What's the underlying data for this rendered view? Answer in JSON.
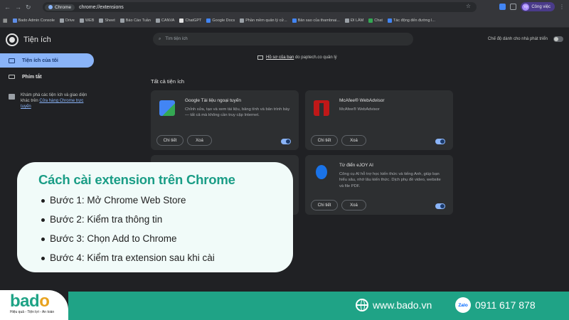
{
  "browser": {
    "site_chip": "Chrome",
    "url": "chrome://extensions",
    "profile_label": "Công việc",
    "profile_initials": "Vy"
  },
  "bookmarks": [
    {
      "label": "Bado Admin Console",
      "color": "#5f8ee8"
    },
    {
      "label": "Drive",
      "color": "#9aa0a6"
    },
    {
      "label": "WEB",
      "color": "#9aa0a6"
    },
    {
      "label": "Sheet",
      "color": "#9aa0a6"
    },
    {
      "label": "Báo Cáo Tuần",
      "color": "#9aa0a6"
    },
    {
      "label": "CANVA",
      "color": "#9aa0a6"
    },
    {
      "label": "ChatGPT",
      "color": "#e3e3e3"
    },
    {
      "label": "Google Docs",
      "color": "#4285f4"
    },
    {
      "label": "Phần mềm quản lý cử...",
      "color": "#9aa0a6"
    },
    {
      "label": "Bản sao của thambnai...",
      "color": "#4285f4"
    },
    {
      "label": "ĐI LÀM",
      "color": "#9aa0a6"
    },
    {
      "label": "Chat",
      "color": "#34a853"
    },
    {
      "label": "Tác động đến đường l...",
      "color": "#4285f4"
    }
  ],
  "header": {
    "title": "Tiện ích",
    "search_placeholder": "Tìm tiện ích",
    "dev_mode_label": "Chế độ dành cho nhà phát triển"
  },
  "sidebar": {
    "items": [
      {
        "label": "Tiện ích của tôi"
      },
      {
        "label": "Phím tắt"
      }
    ],
    "discover_text": "Khám phá các tiện ích và giao diện khác trên ",
    "discover_link": "Cửa hàng Chrome trực tuyến"
  },
  "main": {
    "managed_link": "Hồ sơ của bạn",
    "managed_text": " do paptech.co quản lý",
    "section_title": "Tất cả tiện ích",
    "details_label": "Chi tiết",
    "remove_label": "Xoá",
    "extensions": [
      {
        "name": "Google Tài liệu ngoại tuyến",
        "desc": "Chỉnh sửa, tạo và xem tài liệu, bảng tính và bản trình bày — tất cả mà không cần truy cập Internet.",
        "icon_color": "#4285f4"
      },
      {
        "name": "McAfee® WebAdvisor",
        "desc": "McAfee® WebAdvisor",
        "icon_color": "#c01818"
      },
      {
        "name": "Từ điển eJOY AI",
        "desc": "Công cụ AI hỗ trợ học kiến thức và tiếng Anh, giúp bạn hiểu sâu, nhớ lâu kiến thức. Dịch phụ đề video, website và file PDF.",
        "icon_color": "#1a73e8"
      }
    ]
  },
  "overlay": {
    "title": "Cách cài extension trên Chrome",
    "steps": [
      "Bước 1: Mở Chrome Web Store",
      "Bước 2: Kiểm tra thông tin",
      "Bước 3: Chọn Add to Chrome",
      "Bước 4: Kiểm tra extension sau khi cài"
    ]
  },
  "footer": {
    "brand_pre": "b",
    "brand_a": "a",
    "brand_d": "d",
    "brand_o": "o",
    "tagline": "Hiệu quả - Tiện lợi - An toàn",
    "website": "www.bado.vn",
    "zalo_label": "Zalo",
    "phone": "0911 617 878"
  },
  "colors": {
    "accent_blue": "#8ab4f8",
    "brand_green": "#1fa386",
    "brand_orange": "#e8a21e"
  }
}
